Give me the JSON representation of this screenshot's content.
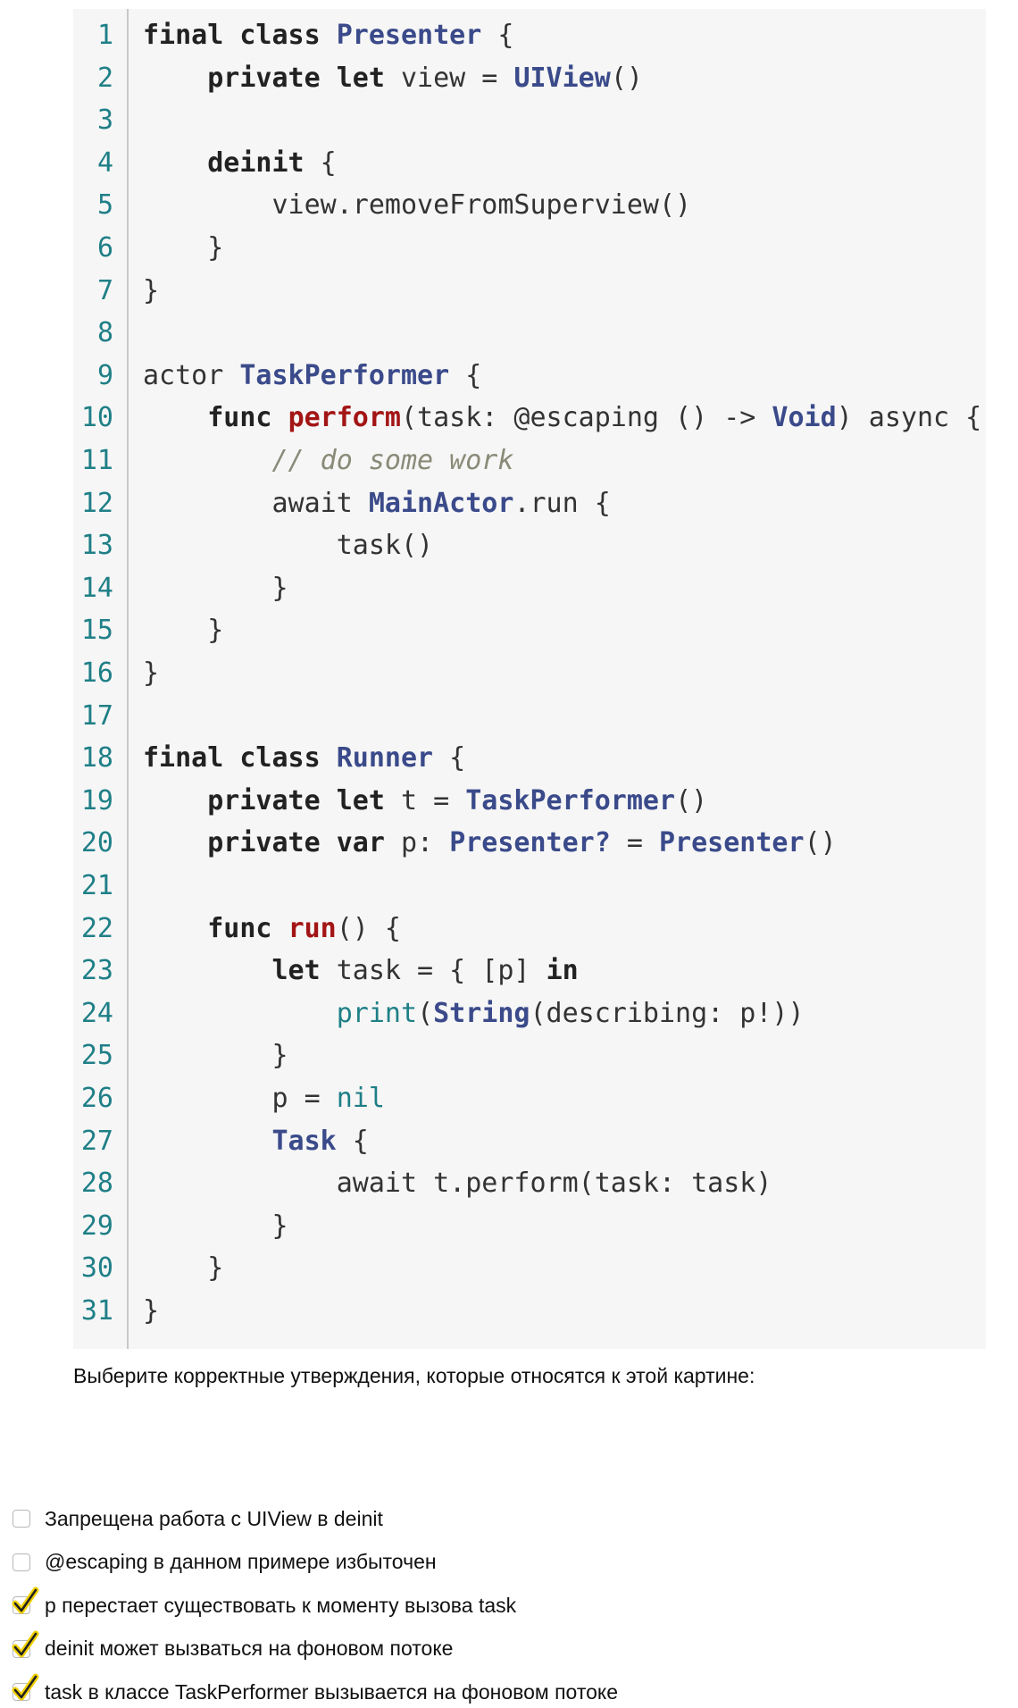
{
  "question": "Выберите корректные утверждения, которые относятся к этой картине:",
  "colors": {
    "line_number": "#1f7f87",
    "keyword": "#222222",
    "type": "#3a4a8a",
    "function_name": "#a31515",
    "builtin": "#1f7f87",
    "comment": "#8a8a78",
    "code_background": "#f6f6f6",
    "checkmark": "#222222",
    "checkmark_fill": "#f0d000"
  },
  "code": [
    {
      "n": "1",
      "tokens": [
        [
          "kw",
          "final class "
        ],
        [
          "ty",
          "Presenter"
        ],
        [
          "p",
          " {"
        ]
      ]
    },
    {
      "n": "2",
      "tokens": [
        [
          "p",
          "    "
        ],
        [
          "kw",
          "private let "
        ],
        [
          "p",
          "view = "
        ],
        [
          "ty",
          "UIView"
        ],
        [
          "p",
          "()"
        ]
      ]
    },
    {
      "n": "3",
      "tokens": []
    },
    {
      "n": "4",
      "tokens": [
        [
          "p",
          "    "
        ],
        [
          "kw",
          "deinit"
        ],
        [
          "p",
          " {"
        ]
      ]
    },
    {
      "n": "5",
      "tokens": [
        [
          "p",
          "        view.removeFromSuperview()"
        ]
      ]
    },
    {
      "n": "6",
      "tokens": [
        [
          "p",
          "    }"
        ]
      ]
    },
    {
      "n": "7",
      "tokens": [
        [
          "p",
          "}"
        ]
      ]
    },
    {
      "n": "8",
      "tokens": []
    },
    {
      "n": "9",
      "tokens": [
        [
          "p",
          "actor "
        ],
        [
          "ty",
          "TaskPerformer"
        ],
        [
          "p",
          " {"
        ]
      ]
    },
    {
      "n": "10",
      "tokens": [
        [
          "p",
          "    "
        ],
        [
          "kw",
          "func "
        ],
        [
          "fn",
          "perform"
        ],
        [
          "p",
          "(task: @escaping () -> "
        ],
        [
          "ty",
          "Void"
        ],
        [
          "p",
          ") async {"
        ]
      ]
    },
    {
      "n": "11",
      "tokens": [
        [
          "p",
          "        "
        ],
        [
          "cm",
          "// do some work"
        ]
      ]
    },
    {
      "n": "12",
      "tokens": [
        [
          "p",
          "        await "
        ],
        [
          "ty",
          "MainActor"
        ],
        [
          "p",
          ".run {"
        ]
      ]
    },
    {
      "n": "13",
      "tokens": [
        [
          "p",
          "            task()"
        ]
      ]
    },
    {
      "n": "14",
      "tokens": [
        [
          "p",
          "        }"
        ]
      ]
    },
    {
      "n": "15",
      "tokens": [
        [
          "p",
          "    }"
        ]
      ]
    },
    {
      "n": "16",
      "tokens": [
        [
          "p",
          "}"
        ]
      ]
    },
    {
      "n": "17",
      "tokens": []
    },
    {
      "n": "18",
      "tokens": [
        [
          "kw",
          "final class "
        ],
        [
          "ty",
          "Runner"
        ],
        [
          "p",
          " {"
        ]
      ]
    },
    {
      "n": "19",
      "tokens": [
        [
          "p",
          "    "
        ],
        [
          "kw",
          "private let "
        ],
        [
          "p",
          "t = "
        ],
        [
          "ty",
          "TaskPerformer"
        ],
        [
          "p",
          "()"
        ]
      ]
    },
    {
      "n": "20",
      "tokens": [
        [
          "p",
          "    "
        ],
        [
          "kw",
          "private var "
        ],
        [
          "p",
          "p: "
        ],
        [
          "ty",
          "Presenter?"
        ],
        [
          "p",
          " = "
        ],
        [
          "ty",
          "Presenter"
        ],
        [
          "p",
          "()"
        ]
      ]
    },
    {
      "n": "21",
      "tokens": []
    },
    {
      "n": "22",
      "tokens": [
        [
          "p",
          "    "
        ],
        [
          "kw",
          "func "
        ],
        [
          "fn",
          "run"
        ],
        [
          "p",
          "() {"
        ]
      ]
    },
    {
      "n": "23",
      "tokens": [
        [
          "p",
          "        "
        ],
        [
          "kw",
          "let "
        ],
        [
          "p",
          "task = { [p] "
        ],
        [
          "kw",
          "in"
        ]
      ]
    },
    {
      "n": "24",
      "tokens": [
        [
          "p",
          "            "
        ],
        [
          "bi",
          "print"
        ],
        [
          "p",
          "("
        ],
        [
          "ty",
          "String"
        ],
        [
          "p",
          "(describing: p!))"
        ]
      ]
    },
    {
      "n": "25",
      "tokens": [
        [
          "p",
          "        }"
        ]
      ]
    },
    {
      "n": "26",
      "tokens": [
        [
          "p",
          "        p = "
        ],
        [
          "bi",
          "nil"
        ]
      ]
    },
    {
      "n": "27",
      "tokens": [
        [
          "p",
          "        "
        ],
        [
          "ty",
          "Task"
        ],
        [
          "p",
          " {"
        ]
      ]
    },
    {
      "n": "28",
      "tokens": [
        [
          "p",
          "            await t.perform(task: task)"
        ]
      ]
    },
    {
      "n": "29",
      "tokens": [
        [
          "p",
          "        }"
        ]
      ]
    },
    {
      "n": "30",
      "tokens": [
        [
          "p",
          "    }"
        ]
      ]
    },
    {
      "n": "31",
      "tokens": [
        [
          "p",
          "}"
        ]
      ]
    }
  ],
  "options": [
    {
      "label": "Запрещена работа с UIView в deinit",
      "checked": false
    },
    {
      "label": "@escaping в данном примере избыточен",
      "checked": false
    },
    {
      "label": "p перестает существовать к моменту вызова task",
      "checked": true
    },
    {
      "label": "deinit может вызваться на фоновом потоке",
      "checked": true
    },
    {
      "label": "task в классе TaskPerformer вызывается на фоновом потоке",
      "checked": true
    }
  ]
}
